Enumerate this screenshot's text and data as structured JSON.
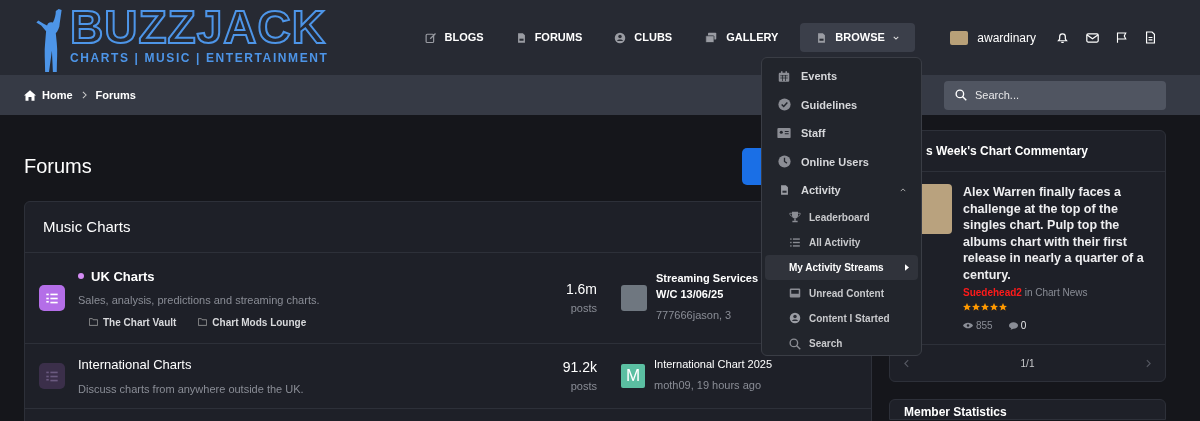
{
  "logo": {
    "wordmark": "BUZZJACK",
    "tagline": "CHARTS | MUSIC | ENTERTAINMENT"
  },
  "nav": [
    {
      "label": "BLOGS",
      "selected": false,
      "dropdown": false
    },
    {
      "label": "FORUMS",
      "selected": false,
      "dropdown": false
    },
    {
      "label": "CLUBS",
      "selected": false,
      "dropdown": false
    },
    {
      "label": "GALLERY",
      "selected": false,
      "dropdown": false
    },
    {
      "label": "BROWSE",
      "selected": true,
      "dropdown": true
    }
  ],
  "user": {
    "name": "awardinary"
  },
  "breadcrumb": [
    "Home",
    "Forums"
  ],
  "search": {
    "placeholder": "Search..."
  },
  "browse_menu": [
    {
      "label": "Events",
      "selected": false
    },
    {
      "label": "Guidelines",
      "selected": false
    },
    {
      "label": "Staff",
      "selected": false
    },
    {
      "label": "Online Users",
      "selected": false
    },
    {
      "label": "Activity",
      "selected": false,
      "expanded": true,
      "children": [
        {
          "label": "Leaderboard",
          "selected": false,
          "submenu": false
        },
        {
          "label": "All Activity",
          "selected": false,
          "submenu": false
        },
        {
          "label": "My Activity Streams",
          "selected": true,
          "submenu": true
        },
        {
          "label": "Unread Content",
          "selected": false,
          "submenu": false
        },
        {
          "label": "Content I Started",
          "selected": false,
          "submenu": false
        },
        {
          "label": "Search",
          "selected": false,
          "submenu": false
        }
      ]
    }
  ],
  "page_title": "Forums",
  "category": {
    "title": "Music Charts",
    "forums": [
      {
        "title": "UK Charts",
        "unread": true,
        "description": "Sales, analysis, predictions and streaming charts.",
        "subforums": [
          "The Chart Vault",
          "Chart Mods Lounge"
        ],
        "count": "1.6m",
        "count_label": "posts",
        "last_post": {
          "title_lines": [
            "Streaming Services",
            "W/C 13/06/25"
          ],
          "meta": "777666jason, 3"
        }
      },
      {
        "title": "International Charts",
        "unread": false,
        "description": "Discuss charts from anywhere outside the UK.",
        "count": "91.2k",
        "count_label": "posts",
        "last_post": {
          "letter": "M",
          "color": "#5bbfa2",
          "title_lines": [
            "International Chart 2025"
          ],
          "meta": "moth09, 19 hours ago"
        }
      }
    ]
  },
  "widget": {
    "title": "s Week's Chart Commentary",
    "text": "Alex Warren finally faces a challenge at the top of the singles chart. Pulp top the albums chart with their first release in nearly a quarter of a century.",
    "author": "Suedehead2",
    "location": "in Chart News",
    "stars": 5,
    "views": "855",
    "comments": "0",
    "pager": "1/1"
  },
  "widget2": {
    "title": "Member Statistics"
  }
}
